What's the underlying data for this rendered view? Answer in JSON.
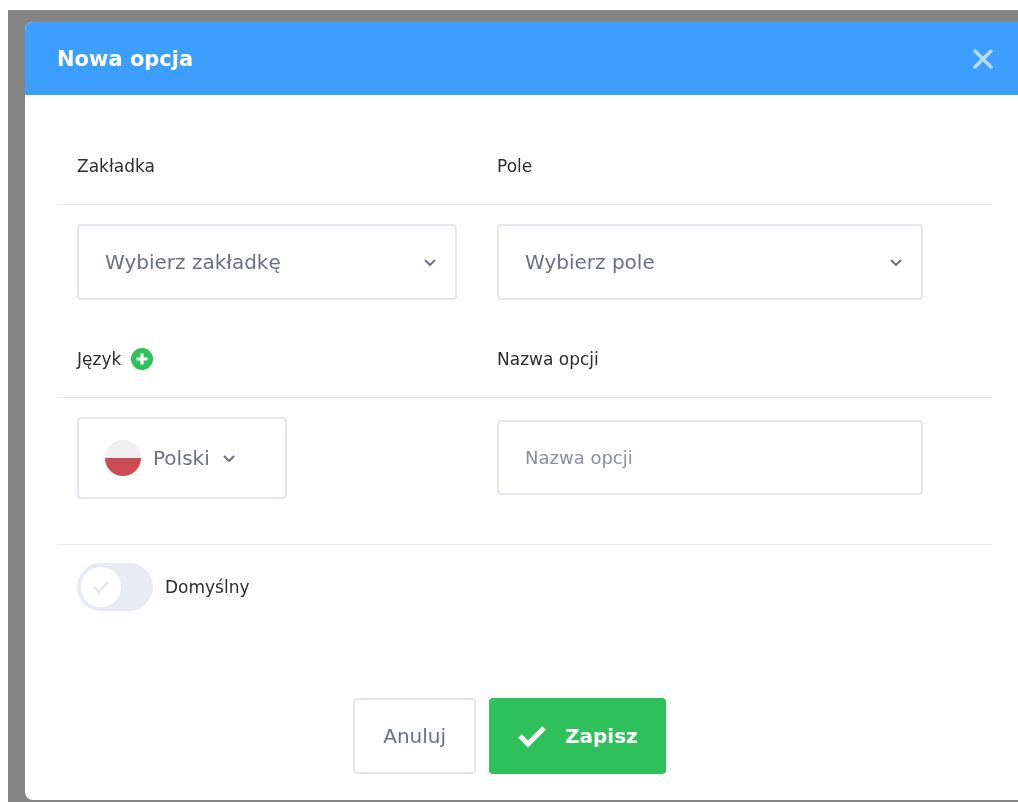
{
  "dialog": {
    "title": "Nowa opcja"
  },
  "fields": [
    {
      "label": "Zakładka",
      "kind": "select",
      "placeholder": "Wybierz zakładkę"
    },
    {
      "label": "Pole",
      "kind": "select",
      "placeholder": "Wybierz pole"
    },
    {
      "label": "Język",
      "kind": "language",
      "value": "Polski",
      "add_button": true
    },
    {
      "label": "Nazwa opcji",
      "kind": "input",
      "placeholder": "Nazwa opcji"
    }
  ],
  "default_toggle": {
    "label": "Domyślny",
    "on": false
  },
  "buttons": [
    {
      "label": "Anuluj",
      "kind": "cancel"
    },
    {
      "label": "Zapisz",
      "kind": "save"
    }
  ]
}
